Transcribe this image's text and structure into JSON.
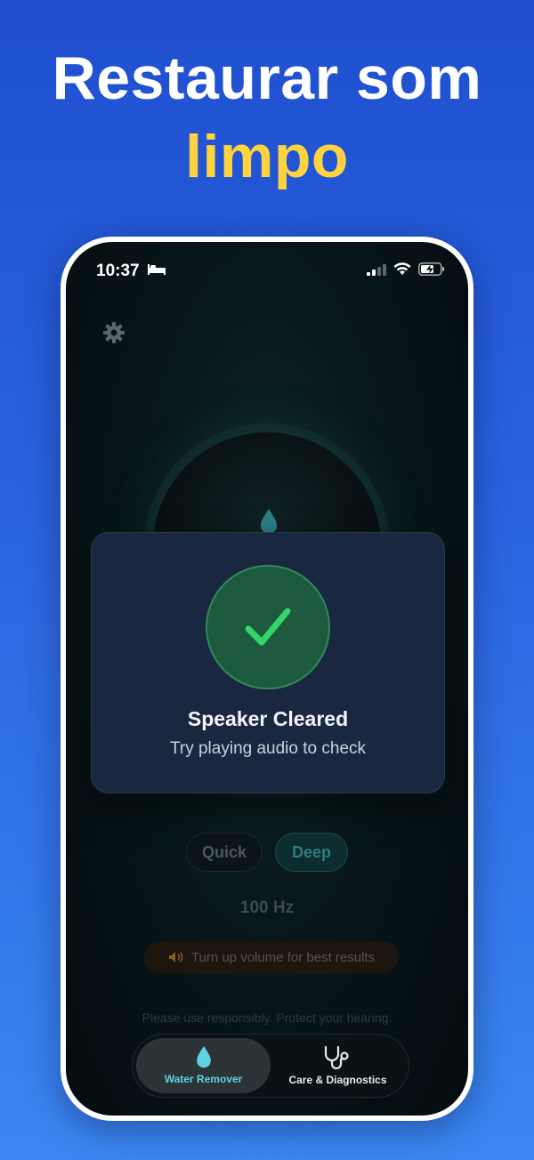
{
  "headline": {
    "line1": "Restaurar som",
    "line2": "limpo"
  },
  "colors": {
    "accent_yellow": "#ffd23f",
    "accent_cyan": "#5fd3e3",
    "success_green": "#35d46b"
  },
  "status_bar": {
    "time": "10:37",
    "icons": [
      "bed-icon",
      "signal-icon",
      "wifi-icon",
      "battery-charging-icon"
    ]
  },
  "modal": {
    "title": "Speaker Cleared",
    "subtitle": "Try playing audio to check",
    "icon": "checkmark-icon"
  },
  "modes": {
    "quick": "Quick",
    "deep": "Deep",
    "selected": "Deep"
  },
  "frequency": "100 Hz",
  "volume_tip": "Turn up volume for best results",
  "disclaimer": "Please use responsibly. Protect your hearing.",
  "tabs": [
    {
      "label": "Water Remover",
      "icon": "water-drop-icon",
      "active": true
    },
    {
      "label": "Care & Diagnostics",
      "icon": "stethoscope-icon",
      "active": false
    }
  ]
}
